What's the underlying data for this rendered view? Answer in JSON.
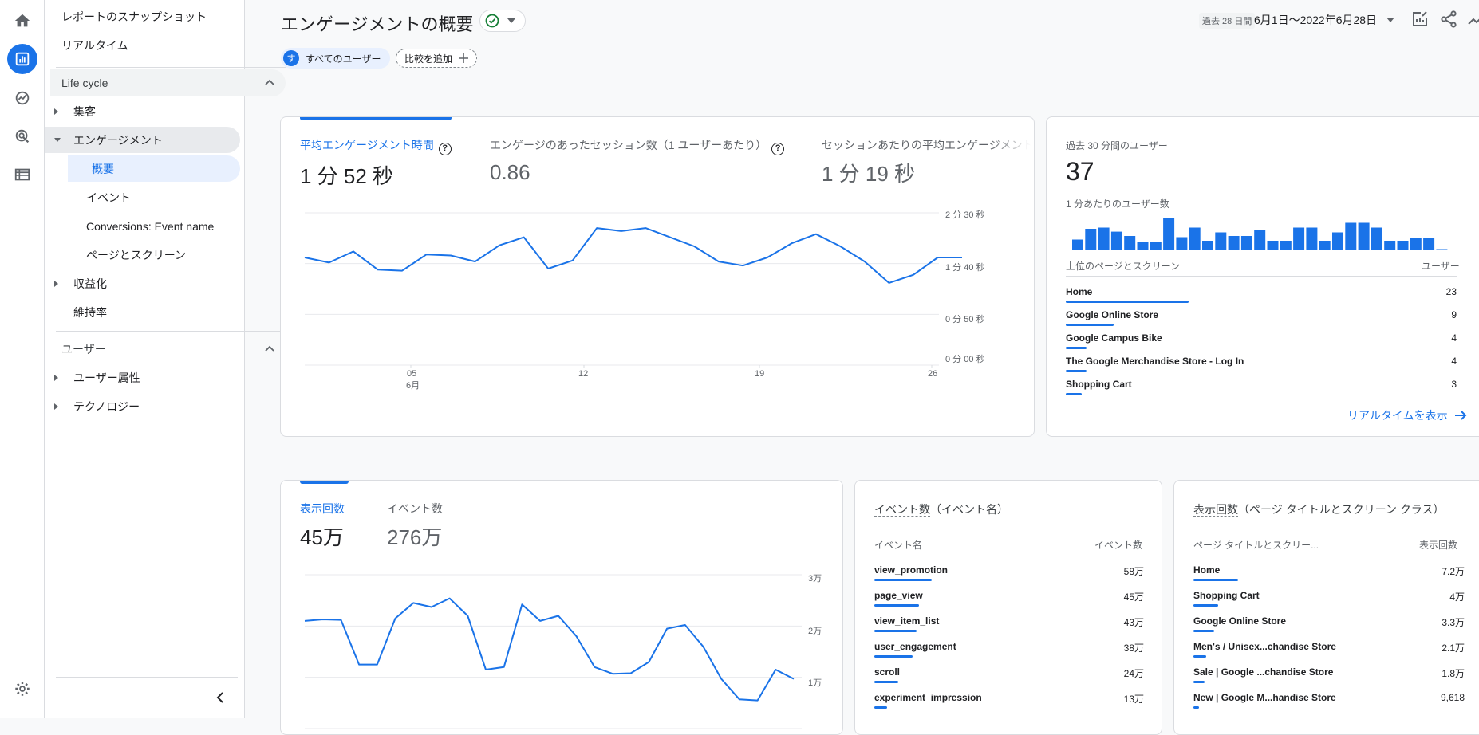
{
  "nav_rail": {
    "items": [
      "home-icon",
      "reports-icon",
      "explore-icon",
      "advertising-icon",
      "configure-icon"
    ],
    "settings": "gear-icon"
  },
  "sidebar": {
    "snapshot": "レポートのスナップショット",
    "realtime": "リアルタイム",
    "lifecycle": "Life cycle",
    "acquisition": "集客",
    "engagement": "エンゲージメント",
    "overview": "概要",
    "events": "イベント",
    "conversions": "Conversions: Event name",
    "pages": "ページとスクリーン",
    "monetization": "収益化",
    "retention": "維持率",
    "user": "ユーザー",
    "user_attributes": "ユーザー属性",
    "technology": "テクノロジー"
  },
  "header": {
    "title": "エンゲージメントの概要",
    "date_label": "過去 28 日間",
    "date_range": "6月1日～2022年6月28日"
  },
  "chips": {
    "user_avatar": "す",
    "user_segment": "すべてのユーザー",
    "compare": "比較を追加"
  },
  "engagement_card": {
    "metrics": [
      {
        "label": "平均エンゲージメント時間",
        "value": "1 分 52 秒"
      },
      {
        "label": "エンゲージのあったセッション数（1 ユーザーあたり）",
        "value": "0.86"
      },
      {
        "label": "セッションあたりの平均エンゲージメント",
        "value": "1 分 19 秒"
      }
    ],
    "y_ticks": [
      "2 分 30 秒",
      "1 分 40 秒",
      "0 分 50 秒",
      "0 分 00 秒"
    ],
    "x_ticks": [
      "05",
      "12",
      "19",
      "26"
    ],
    "x_month": "6月"
  },
  "realtime_card": {
    "title": "過去 30 分間のユーザー",
    "value": "37",
    "subtitle": "1 分あたりのユーザー数",
    "table_title": "上位のページとスクリーン",
    "table_col": "ユーザー",
    "rows": [
      {
        "name": "Home",
        "value": "23"
      },
      {
        "name": "Google Online Store",
        "value": "9"
      },
      {
        "name": "Google Campus Bike",
        "value": "4"
      },
      {
        "name": "The Google Merchandise Store - Log In",
        "value": "4"
      },
      {
        "name": "Shopping Cart",
        "value": "3"
      }
    ],
    "row_shares": [
      1.0,
      0.39,
      0.17,
      0.17,
      0.13
    ],
    "bars": [
      0.45,
      0.9,
      0.95,
      0.78,
      0.6,
      0.35,
      0.35,
      1.35,
      0.55,
      0.95,
      0.4,
      0.75,
      0.6,
      0.6,
      0.85,
      0.4,
      0.4,
      0.95,
      0.95,
      0.4,
      0.75,
      1.15,
      1.15,
      0.95,
      0.4,
      0.4,
      0.5,
      0.5,
      0.05
    ],
    "link": "リアルタイムを表示"
  },
  "views_card": {
    "metrics": [
      {
        "label": "表示回数",
        "value": "45万"
      },
      {
        "label": "イベント数",
        "value": "276万"
      }
    ],
    "y_ticks": [
      "3万",
      "2万",
      "1万"
    ]
  },
  "events_card": {
    "title_main": "イベント数",
    "title_sub": "（イベント名）",
    "col_name": "イベント名",
    "col_value": "イベント数",
    "rows": [
      {
        "name": "view_promotion",
        "value": "58万"
      },
      {
        "name": "page_view",
        "value": "45万"
      },
      {
        "name": "view_item_list",
        "value": "43万"
      },
      {
        "name": "user_engagement",
        "value": "38万"
      },
      {
        "name": "scroll",
        "value": "24万"
      },
      {
        "name": "experiment_impression",
        "value": "13万"
      }
    ],
    "row_shares": [
      1.0,
      0.78,
      0.74,
      0.66,
      0.41,
      0.22
    ]
  },
  "pages_card": {
    "title_main": "表示回数",
    "title_sub": "（ページ タイトルとスクリーン クラス）",
    "col_name": "ページ タイトルとスクリー...",
    "col_value": "表示回数",
    "rows": [
      {
        "name": "Home",
        "value": "7.2万"
      },
      {
        "name": "Shopping Cart",
        "value": "4万"
      },
      {
        "name": "Google Online Store",
        "value": "3.3万"
      },
      {
        "name": "Men's / Unisex...chandise Store",
        "value": "2.1万"
      },
      {
        "name": "Sale | Google ...chandise Store",
        "value": "1.8万"
      },
      {
        "name": "New | Google M...handise Store",
        "value": "9,618"
      }
    ],
    "row_shares": [
      1.0,
      0.56,
      0.46,
      0.29,
      0.25,
      0.13
    ]
  },
  "chart_data": [
    {
      "type": "line",
      "series": [
        {
          "name": "",
          "values": [
            106,
            101,
            112,
            94,
            93,
            109,
            108,
            102,
            118,
            126,
            95,
            103,
            135,
            132,
            135,
            126,
            117,
            102,
            98,
            106,
            120,
            129,
            117,
            102,
            81,
            89,
            106,
            106
          ]
        }
      ],
      "ylim": [
        0,
        150
      ],
      "x_ticks": [
        "05",
        "12",
        "19",
        "26"
      ]
    },
    {
      "type": "line",
      "series": [
        {
          "name": "",
          "values": [
            2.1,
            2.13,
            2.12,
            1.25,
            1.25,
            2.15,
            2.45,
            2.37,
            2.54,
            2.2,
            1.15,
            1.2,
            2.42,
            2.1,
            2.2,
            1.8,
            1.2,
            1.07,
            1.08,
            1.3,
            1.95,
            2.02,
            1.6,
            0.97,
            0.57,
            0.55,
            1.15,
            0.97
          ]
        }
      ],
      "ylim": [
        0,
        3
      ]
    }
  ]
}
